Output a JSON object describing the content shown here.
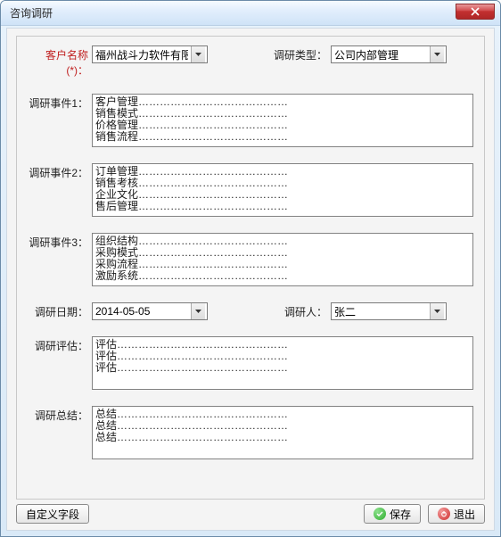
{
  "window": {
    "title": "咨询调研"
  },
  "form": {
    "customer_label": "客户名称(*)：",
    "customer_value": "福州战斗力软件有限",
    "type_label": "调研类型：",
    "type_value": "公司内部管理",
    "event1_label": "调研事件1：",
    "event1_value": "客户管理……………………………………\n销售模式……………………………………\n价格管理……………………………………\n销售流程……………………………………",
    "event2_label": "调研事件2：",
    "event2_value": "订单管理……………………………………\n销售考核……………………………………\n企业文化……………………………………\n售后管理……………………………………",
    "event3_label": "调研事件3：",
    "event3_value": "组织结构……………………………………\n采购模式……………………………………\n采购流程……………………………………\n激励系统……………………………………",
    "date_label": "调研日期：",
    "date_value": "2014-05-05",
    "person_label": "调研人：",
    "person_value": "张二",
    "eval_label": "调研评估：",
    "eval_value": "评估…………………………………………\n评估…………………………………………\n评估…………………………………………",
    "summary_label": "调研总结：",
    "summary_value": "总结…………………………………………\n总结…………………………………………\n总结…………………………………………"
  },
  "buttons": {
    "custom_field": "自定义字段",
    "save": "保存",
    "exit": "退出"
  }
}
